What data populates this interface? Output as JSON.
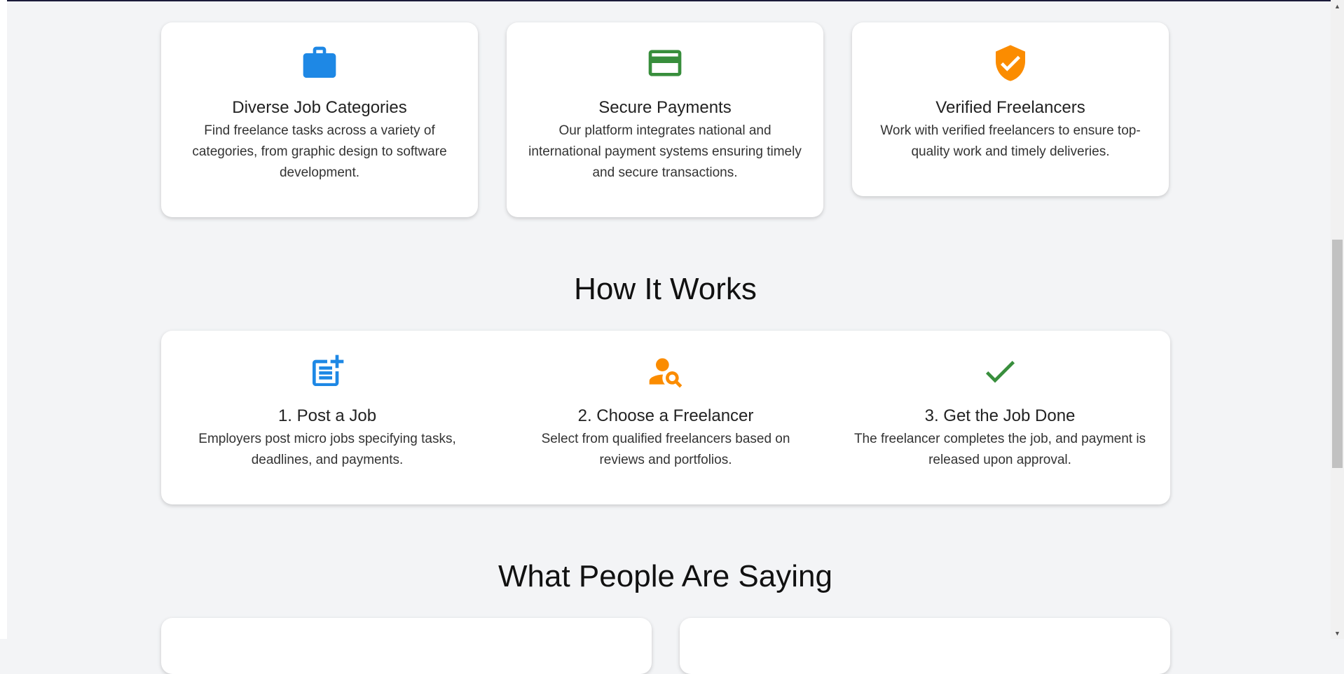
{
  "features": [
    {
      "icon": "briefcase-icon",
      "color": "#1e88e5",
      "title": "Diverse Job Categories",
      "description": "Find freelance tasks across a variety of categories, from graphic design to software development."
    },
    {
      "icon": "credit-card-icon",
      "color": "#388e3c",
      "title": "Secure Payments",
      "description": "Our platform integrates national and international payment systems ensuring timely and secure transactions."
    },
    {
      "icon": "verified-shield-icon",
      "color": "#fb8c00",
      "title": "Verified Freelancers",
      "description": "Work with verified freelancers to ensure top-quality work and timely deliveries."
    }
  ],
  "how_it_works": {
    "heading": "How It Works",
    "steps": [
      {
        "icon": "post-add-icon",
        "color": "#1e88e5",
        "title": "1. Post a Job",
        "description": "Employers post micro jobs specifying tasks, deadlines, and payments."
      },
      {
        "icon": "person-search-icon",
        "color": "#fb8c00",
        "title": "2. Choose a Freelancer",
        "description": "Select from qualified freelancers based on reviews and portfolios."
      },
      {
        "icon": "checkmark-icon",
        "color": "#388e3c",
        "title": "3. Get the Job Done",
        "description": "The freelancer completes the job, and payment is released upon approval."
      }
    ]
  },
  "testimonials": {
    "heading": "What People Are Saying"
  }
}
